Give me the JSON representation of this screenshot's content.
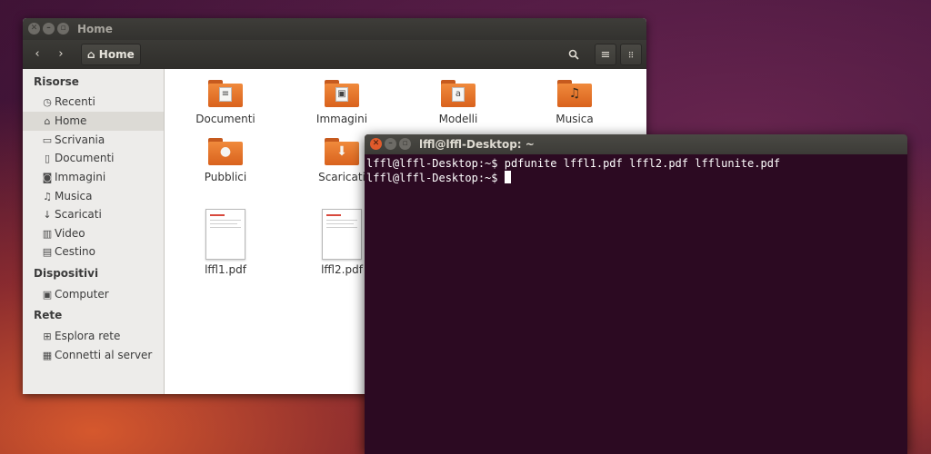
{
  "files_window": {
    "title": "Home",
    "path_label": "Home",
    "sidebar": {
      "sections": [
        {
          "heading": "Risorse",
          "items": [
            {
              "label": "Recenti",
              "icon": "clock-icon",
              "active": false
            },
            {
              "label": "Home",
              "icon": "home-icon",
              "active": true
            },
            {
              "label": "Scrivania",
              "icon": "desktop-folder-icon",
              "active": false
            },
            {
              "label": "Documenti",
              "icon": "document-icon",
              "active": false
            },
            {
              "label": "Immagini",
              "icon": "camera-icon",
              "active": false
            },
            {
              "label": "Musica",
              "icon": "music-note-icon",
              "active": false
            },
            {
              "label": "Scaricati",
              "icon": "download-icon",
              "active": false
            },
            {
              "label": "Video",
              "icon": "film-icon",
              "active": false
            },
            {
              "label": "Cestino",
              "icon": "trash-icon",
              "active": false
            }
          ]
        },
        {
          "heading": "Dispositivi",
          "items": [
            {
              "label": "Computer",
              "icon": "computer-icon",
              "active": false
            }
          ]
        },
        {
          "heading": "Rete",
          "items": [
            {
              "label": "Esplora rete",
              "icon": "network-icon",
              "active": false
            },
            {
              "label": "Connetti al server",
              "icon": "server-icon",
              "active": false
            }
          ]
        }
      ]
    },
    "items": [
      {
        "name": "Documenti",
        "kind": "folder",
        "emblem": "document-icon"
      },
      {
        "name": "Immagini",
        "kind": "folder",
        "emblem": "picture-icon"
      },
      {
        "name": "Modelli",
        "kind": "folder",
        "emblem": "template-icon"
      },
      {
        "name": "Musica",
        "kind": "folder",
        "emblem": "music-note-icon"
      },
      {
        "name": "Pubblici",
        "kind": "folder",
        "emblem": "user-icon"
      },
      {
        "name": "Scaricati",
        "kind": "folder",
        "emblem": "download-icon"
      },
      {
        "name": "lffl1.pdf",
        "kind": "pdf"
      },
      {
        "name": "lffl2.pdf",
        "kind": "pdf"
      }
    ]
  },
  "terminal": {
    "title": "lffl@lffl-Desktop: ~",
    "lines": [
      "lffl@lffl-Desktop:~$ pdfunite lffl1.pdf lffl2.pdf lfflunite.pdf",
      "lffl@lffl-Desktop:~$ "
    ]
  },
  "colors": {
    "folder_orange": "#e8762d",
    "terminal_bg": "#2c0a22",
    "titlebar": "#3c3b37",
    "close_orange": "#e05a2b"
  }
}
